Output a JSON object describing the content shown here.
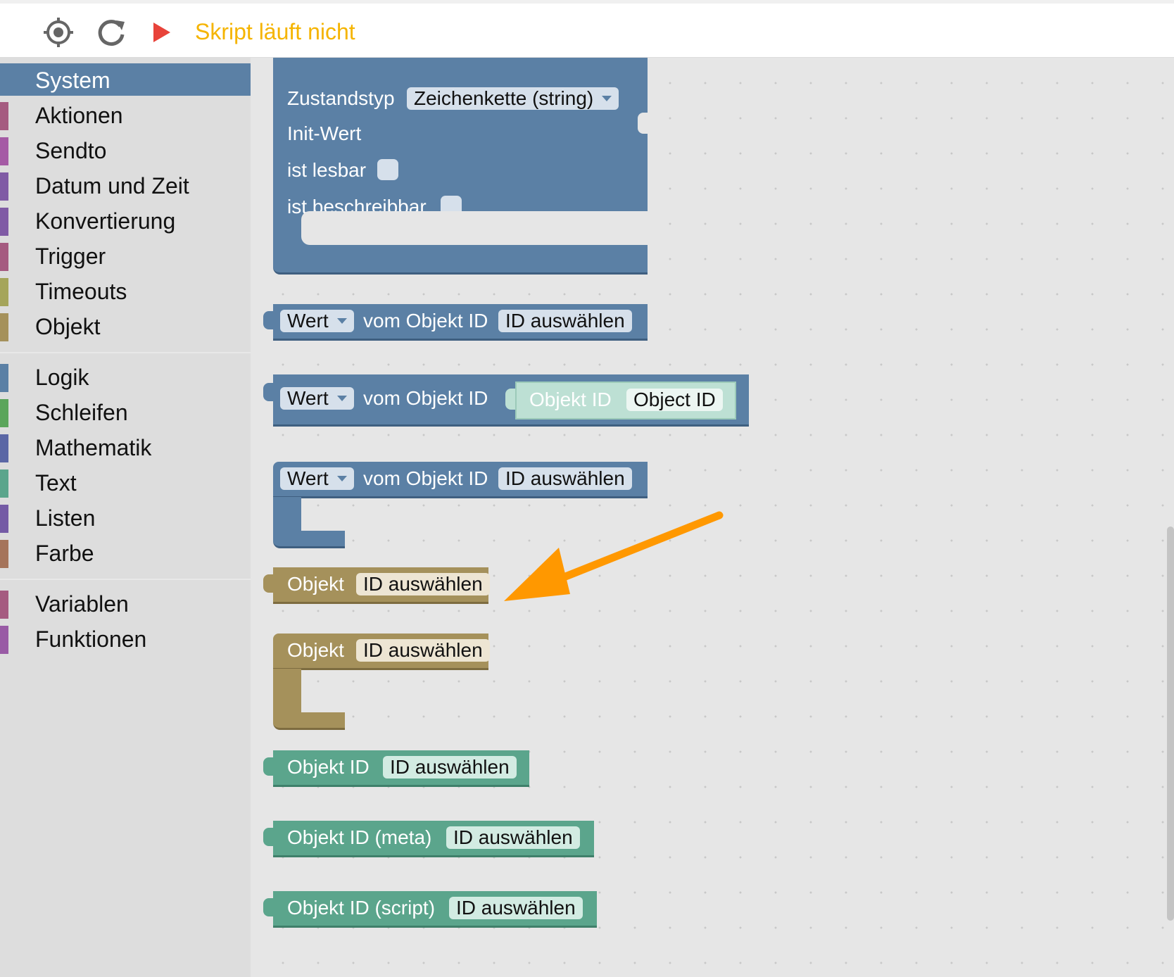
{
  "toolbar": {
    "target_icon": "crosshair-icon",
    "reload_icon": "reload-icon",
    "run_icon": "play-icon",
    "status_text": "Skript läuft nicht",
    "status_color": "#f5b400",
    "run_color": "#e8433a"
  },
  "sidebar": {
    "categories": [
      {
        "label": "System",
        "color": "#5b80a5",
        "selected": true
      },
      {
        "label": "Aktionen",
        "color": "#a55b80"
      },
      {
        "label": "Sendto",
        "color": "#a55ba5"
      },
      {
        "label": "Datum und Zeit",
        "color": "#805ba5"
      },
      {
        "label": "Konvertierung",
        "color": "#805ba5"
      },
      {
        "label": "Trigger",
        "color": "#a55b80"
      },
      {
        "label": "Timeouts",
        "color": "#a5a55b"
      },
      {
        "label": "Objekt",
        "color": "#a5915b"
      },
      {
        "label": "Logik",
        "color": "#5b80a5"
      },
      {
        "label": "Schleifen",
        "color": "#5ba55b"
      },
      {
        "label": "Mathematik",
        "color": "#5b67a5"
      },
      {
        "label": "Text",
        "color": "#5ba58c"
      },
      {
        "label": "Listen",
        "color": "#745ba5"
      },
      {
        "label": "Farbe",
        "color": "#a5745b"
      },
      {
        "label": "Variablen",
        "color": "#a55b80"
      },
      {
        "label": "Funktionen",
        "color": "#995ba5"
      }
    ]
  },
  "workspace": {
    "create_state": {
      "type_label": "Zustandstyp",
      "type_value": "Zeichenkette (string)",
      "init_label": "Init-Wert",
      "readable_label": "ist lesbar",
      "writable_label": "ist beschreibbar"
    },
    "value_block_1": {
      "dropdown": "Wert",
      "label": "vom Objekt ID",
      "field": "ID auswählen"
    },
    "value_block_2": {
      "dropdown": "Wert",
      "label": "vom Objekt ID",
      "inner_label": "Objekt ID",
      "inner_field": "Object ID"
    },
    "value_block_3": {
      "dropdown": "Wert",
      "label": "vom Objekt ID",
      "field": "ID auswählen"
    },
    "object_block_1": {
      "label": "Objekt",
      "field": "ID auswählen"
    },
    "object_block_2": {
      "label": "Objekt",
      "field": "ID auswählen"
    },
    "objectid_block": {
      "label": "Objekt ID",
      "field": "ID auswählen"
    },
    "objectid_meta_block": {
      "label": "Objekt ID (meta)",
      "field": "ID auswählen"
    },
    "objectid_script_block": {
      "label": "Objekt ID (script)",
      "field": "ID auswählen"
    },
    "annotation_arrow_color": "#ff9800"
  }
}
